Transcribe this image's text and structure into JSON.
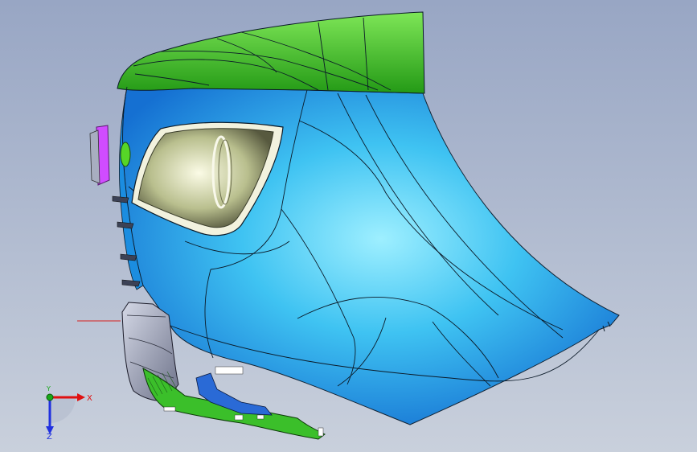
{
  "viewport": {
    "background_top": "#98a6c4",
    "background_bottom": "#c9d0dc"
  },
  "model": {
    "colors": {
      "body_blue": "#27a7ea",
      "body_blue_light": "#86e6ff",
      "body_blue_dark": "#1780d6",
      "spoiler_green": "#2fb11f",
      "spoiler_green_light": "#79e553",
      "lamp_magenta": "#d04cff",
      "lamp_recess": "#d0d4a8",
      "diffuser_gray": "#a9aec3",
      "curve_black": "#0b1a28",
      "pick_line_red": "#d82020"
    }
  },
  "triad": {
    "x_label": "X",
    "y_label": "Y",
    "z_label": "Z",
    "x_color": "#e01010",
    "y_color": "#18a818",
    "z_color": "#2030e0"
  }
}
